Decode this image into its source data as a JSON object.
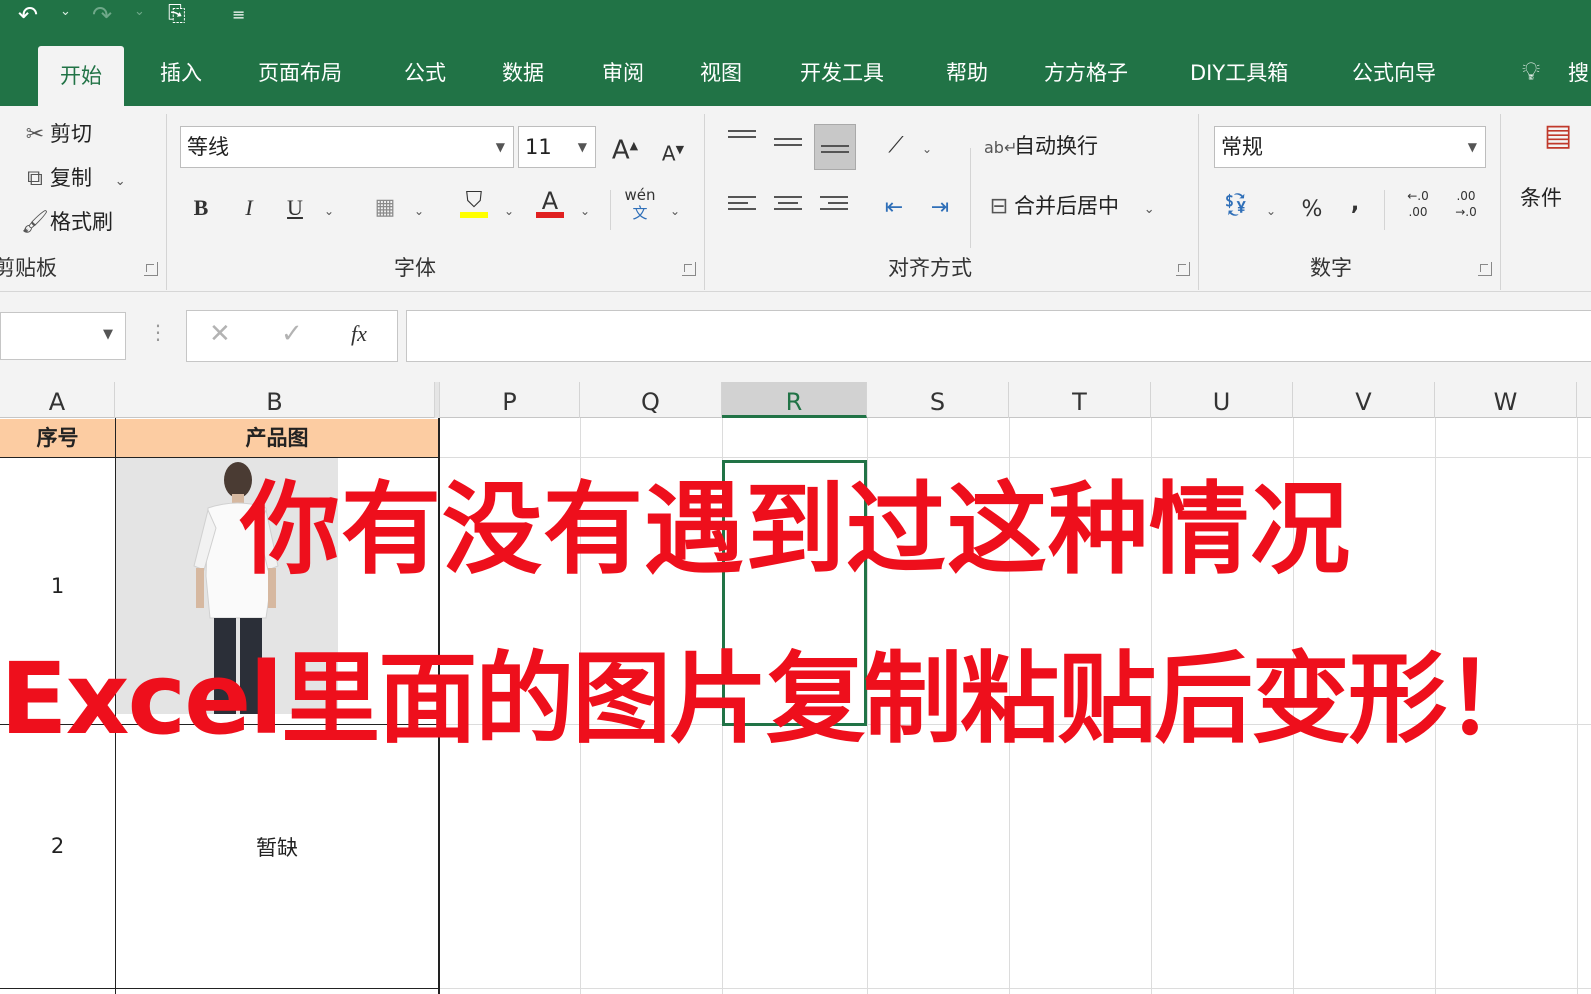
{
  "window": {
    "qat": {
      "undo_icon": "undo-icon",
      "redo_icon": "redo-icon",
      "touch_icon": "touch-mode-icon",
      "customize_icon": "customize-qat-icon"
    }
  },
  "ribbon_tabs": [
    {
      "label": "开始",
      "active": true
    },
    {
      "label": "插入"
    },
    {
      "label": "页面布局"
    },
    {
      "label": "公式"
    },
    {
      "label": "数据"
    },
    {
      "label": "审阅"
    },
    {
      "label": "视图"
    },
    {
      "label": "开发工具"
    },
    {
      "label": "帮助"
    },
    {
      "label": "方方格子"
    },
    {
      "label": "DIY工具箱"
    },
    {
      "label": "公式向导"
    },
    {
      "label": "搜"
    }
  ],
  "clipboard": {
    "cut": "剪切",
    "copy": "复制",
    "format_painter": "格式刷",
    "group_label": "剪贴板"
  },
  "font": {
    "font_name": "等线",
    "font_size": "11",
    "increase": "A",
    "decrease": "A",
    "bold": "B",
    "italic": "I",
    "underline": "U",
    "font_color": "A",
    "phonetic": "wén",
    "phonetic_sub": "文",
    "group_label": "字体"
  },
  "alignment": {
    "wrap_text": "自动换行",
    "merge_center": "合并后居中",
    "group_label": "对齐方式"
  },
  "number": {
    "format": "常规",
    "percent": "%",
    "comma": ",",
    "inc_decimal": "←.0 .00",
    "dec_decimal": ".00 →.0",
    "group_label": "数字"
  },
  "styles": {
    "conditional": "条件"
  },
  "formula_bar": {
    "name_box": "",
    "cancel": "✕",
    "enter": "✓",
    "fx": "fx",
    "content": ""
  },
  "columns": [
    "A",
    "B",
    "P",
    "Q",
    "R",
    "S",
    "T",
    "U",
    "V",
    "W"
  ],
  "selected_column": "R",
  "table": {
    "headers": [
      "序号",
      "产品图"
    ],
    "rows": [
      {
        "index": "1",
        "image": "product-photo"
      },
      {
        "index": "2",
        "text": "暂缺"
      }
    ]
  },
  "overlay_caption": {
    "line1": "你有没有遇到过这种情况",
    "line2": "Excel里面的图片复制粘贴后变形！"
  },
  "colors": {
    "excel_green": "#217346",
    "header_fill": "#fccca2",
    "caption_red": "#ee0f1c"
  }
}
